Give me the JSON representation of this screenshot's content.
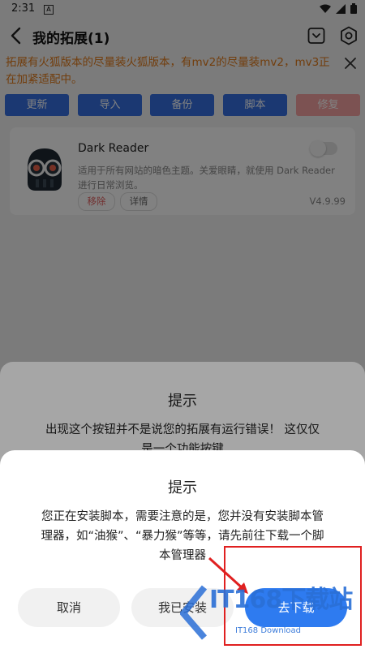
{
  "status": {
    "time": "2:31"
  },
  "header": {
    "title": "我的拓展(1)"
  },
  "notice": {
    "text": "拓展有火狐版本的尽量装火狐版本，有mv2的尽量装mv2，mv3正在加紧适配中。"
  },
  "actions": [
    {
      "label": "更新"
    },
    {
      "label": "导入"
    },
    {
      "label": "备份"
    },
    {
      "label": "脚本"
    },
    {
      "label": "修复"
    }
  ],
  "extension": {
    "name": "Dark Reader",
    "description": "适用于所有网站的暗色主题。关爱眼睛，就使用 Dark Reader 进行日常浏览。",
    "remove_label": "移除",
    "details_label": "详情",
    "version": "V4.9.99",
    "enabled": false
  },
  "background_dialog": {
    "title": "提示",
    "message": "出现这个按钮并不是说您的拓展有运行错误！ 这仅仅是一个功能按键"
  },
  "dialog": {
    "title": "提示",
    "message": "您正在安装脚本，需要注意的是，您并没有安装脚本管理器，如“油猴”、“暴力猴”等等，请先前往下载一个脚本管理器",
    "cancel_label": "取消",
    "installed_label": "我已安装",
    "download_label": "去下载"
  },
  "watermark": {
    "text": "IT168下载站",
    "sub": "IT168 Download"
  },
  "colors": {
    "accent": "#3770e0",
    "notice": "#e07a19",
    "danger": "#e02020"
  }
}
